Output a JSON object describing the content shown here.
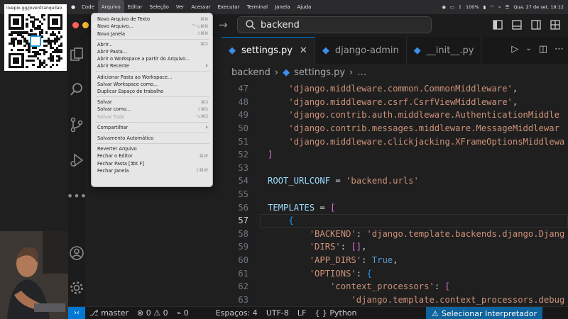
{
  "menubar": {
    "items": [
      "Code",
      "Arquivo",
      "Editar",
      "Seleção",
      "Ver",
      "Acessar",
      "Executar",
      "Terminal",
      "Janela",
      "Ajuda"
    ],
    "active_index": 1,
    "battery": "100%",
    "clock": "Qua. 27 de set.  19:12"
  },
  "overlay": {
    "url": "livepix.gg/joventranquilao"
  },
  "titlebar": {
    "search": "backend"
  },
  "tabs": [
    {
      "label": "settings.py",
      "close": "✕"
    },
    {
      "label": "django-admin"
    },
    {
      "label": "__init__.py"
    }
  ],
  "breadcrumb": {
    "root": "backend",
    "sep": "›",
    "file": "settings.py",
    "tail": "…"
  },
  "code": {
    "current_line": 57,
    "lines": [
      {
        "n": "47",
        "t": "    'django.middleware.common.CommonMiddleware',"
      },
      {
        "n": "48",
        "t": "    'django.middleware.csrf.CsrfViewMiddleware',"
      },
      {
        "n": "49",
        "t": "    'django.contrib.auth.middleware.AuthenticationMiddle"
      },
      {
        "n": "50",
        "t": "    'django.contrib.messages.middleware.MessageMiddlewar"
      },
      {
        "n": "51",
        "t": "    'django.middleware.clickjacking.XFrameOptionsMiddlewa"
      },
      {
        "n": "52",
        "t": "]"
      },
      {
        "n": "53",
        "t": ""
      },
      {
        "n": "54",
        "t": "ROOT_URLCONF = 'backend.urls'"
      },
      {
        "n": "55",
        "t": ""
      },
      {
        "n": "56",
        "t": "TEMPLATES = ["
      },
      {
        "n": "57",
        "t": "    {"
      },
      {
        "n": "58",
        "t": "        'BACKEND': 'django.template.backends.django.Djang"
      },
      {
        "n": "59",
        "t": "        'DIRS': [],"
      },
      {
        "n": "60",
        "t": "        'APP_DIRS': True,"
      },
      {
        "n": "61",
        "t": "        'OPTIONS': {"
      },
      {
        "n": "62",
        "t": "            'context_processors': ["
      },
      {
        "n": "63",
        "t": "                'django.template.context_processors.debug"
      }
    ]
  },
  "statusbar": {
    "branch": "master",
    "errors": "0",
    "warnings": "0",
    "ports": "0",
    "spaces": "Espaços: 4",
    "encoding": "UTF-8",
    "eol": "LF",
    "language": "Python",
    "interpreter": "Selecionar Interpretador"
  },
  "file_menu": {
    "items": [
      {
        "label": "Novo Arquivo de Texto",
        "shortcut": "⌘N"
      },
      {
        "label": "Novo Arquivo...",
        "shortcut": "^⌥⌘N"
      },
      {
        "label": "Nova Janela",
        "shortcut": "⇧⌘N"
      },
      {
        "sep": true
      },
      {
        "label": "Abrir...",
        "shortcut": "⌘O"
      },
      {
        "label": "Abrir Pasta..."
      },
      {
        "label": "Abrir o Workspace a partir do Arquivo..."
      },
      {
        "label": "Abrir Recente",
        "arrow": "›"
      },
      {
        "sep": true
      },
      {
        "label": "Adicionar Pasta ao Workspace..."
      },
      {
        "label": "Salvar Workspace como..."
      },
      {
        "label": "Duplicar Espaço de trabalho"
      },
      {
        "sep": true
      },
      {
        "label": "Salvar",
        "shortcut": "⌘S"
      },
      {
        "label": "Salvar como...",
        "shortcut": "⇧⌘S"
      },
      {
        "label": "Salvar Tudo",
        "shortcut": "⌥⌘S",
        "disabled": true
      },
      {
        "sep": true
      },
      {
        "label": "Compartilhar",
        "arrow": "›"
      },
      {
        "sep": true
      },
      {
        "label": "Salvamento Automático"
      },
      {
        "sep": true
      },
      {
        "label": "Reverter Arquivo"
      },
      {
        "label": "Fechar o Editor",
        "shortcut": "⌘W"
      },
      {
        "label": "Fechar Pasta [⌘K F]"
      },
      {
        "label": "Fechar Janela",
        "shortcut": "⇧⌘W"
      }
    ]
  }
}
